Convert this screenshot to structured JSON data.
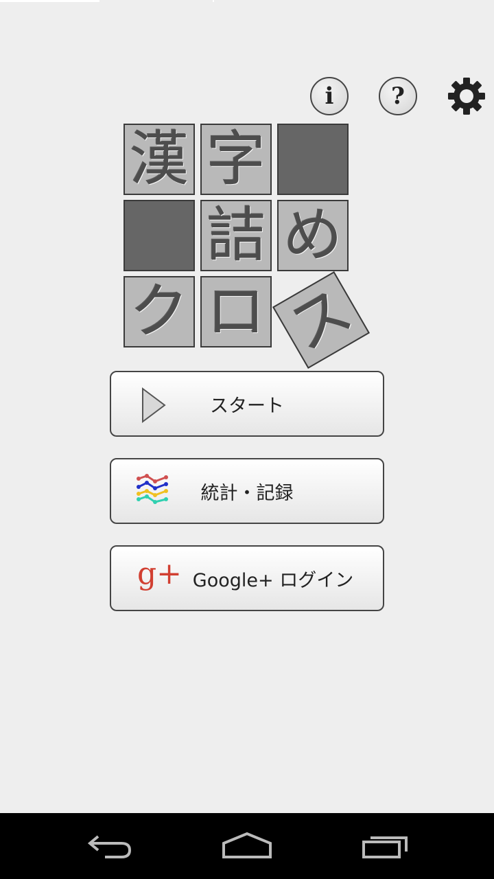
{
  "header": {
    "info_label": "i",
    "help_label": "?"
  },
  "logo": {
    "tiles": [
      "漢",
      "字",
      "詰",
      "め",
      "ク",
      "ロ",
      "ス"
    ]
  },
  "menu": {
    "start_label": "スタート",
    "stats_label": "統計・記録",
    "google_label": "Google+ ログイン",
    "google_icon_text": "g+"
  },
  "icons": {
    "start": "play-icon",
    "stats": "chart-lines-icon",
    "google": "google-plus-icon",
    "settings": "gear-icon",
    "nav_back": "back-arrow-icon",
    "nav_home": "home-icon",
    "nav_recent": "recent-apps-icon"
  },
  "colors": {
    "background": "#eeeeee",
    "tile": "#b9b9b9",
    "tile_dark": "#666666",
    "google_red": "#d13f31",
    "navbar": "#000000"
  }
}
